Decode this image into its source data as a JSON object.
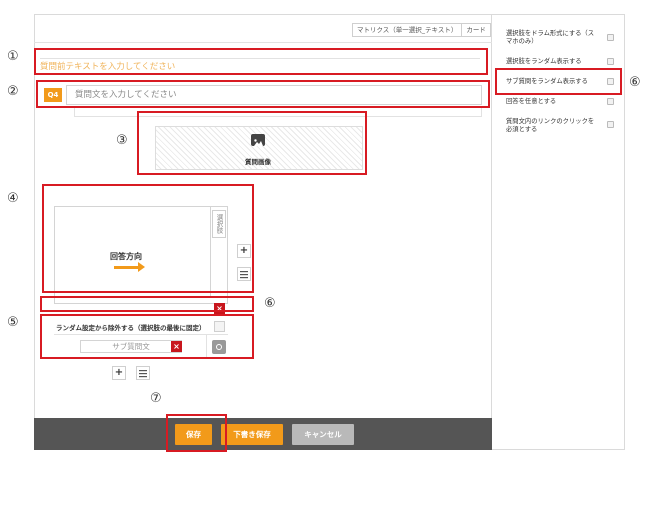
{
  "tabs": [
    "マトリクス（単一選択_テキスト）",
    "カード"
  ],
  "markers": [
    "①",
    "②",
    "③",
    "④",
    "⑤",
    "⑥",
    "⑥",
    "⑦"
  ],
  "question": {
    "pre_text_placeholder": "質問前テキストを入力してください",
    "badge": "Q4",
    "placeholder": "質問文を入力してください"
  },
  "image_area": {
    "icon": "image-icon",
    "label": "質問画像"
  },
  "matrix": {
    "answer_direction": "回答方向",
    "option_cell": "選択肢",
    "exclude_label": "ランダム設定から除外する（選択肢の最後に固定）",
    "sub_question_placeholder": "サブ質問文"
  },
  "footer": {
    "save": "保存",
    "draft_save": "下書き保存",
    "cancel": "キャンセル"
  },
  "settings": [
    "選択肢をドラム形式にする（スマホのみ）",
    "選択肢をランダム表示する",
    "サブ質問をランダム表示する",
    "回答を任意とする",
    "質問文内のリンクのクリックを必須とする"
  ],
  "colors": {
    "accent": "#f29a1a",
    "highlight": "#d81b23",
    "footer": "#555555"
  }
}
